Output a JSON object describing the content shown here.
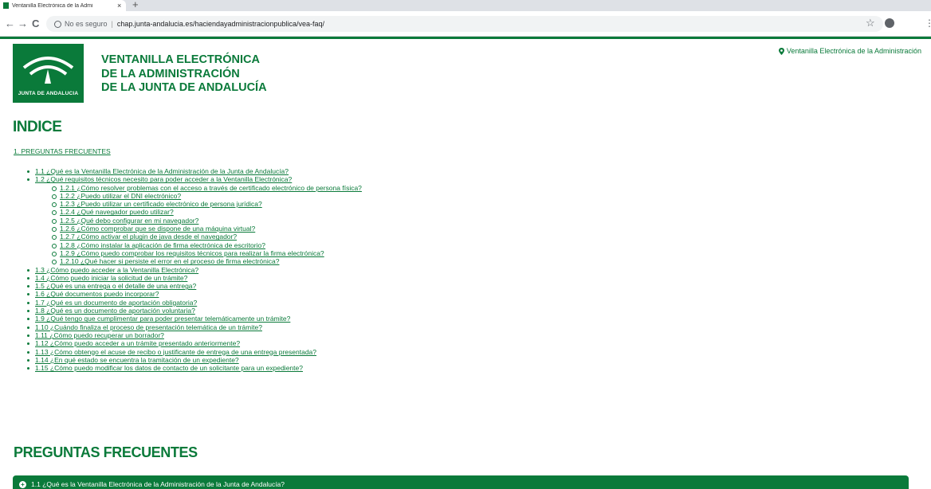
{
  "browser": {
    "tab_title": "Ventanilla Electrónica de la Admi",
    "tab_close": "×",
    "new_tab": "+",
    "back": "←",
    "forward": "→",
    "reload": "C",
    "security_label": "No es seguro",
    "url": "chap.junta-andalucia.es/haciendayadministracionpublica/vea-faq/",
    "star": "☆",
    "menu": "⋮"
  },
  "header": {
    "logo_text": "JUNTA DE ANDALUCIA",
    "title_line1": "VENTANILLA ELECTRÓNICA",
    "title_line2": "DE LA ADMINISTRACIÓN",
    "title_line3": "DE LA JUNTA DE ANDALUCÍA",
    "top_link": "Ventanilla Electrónica de la Administración"
  },
  "index": {
    "heading": "INDICE",
    "section_link": "1. PREGUNTAS FRECUENTES",
    "items": [
      {
        "label": "1.1 ¿Qué es la Ventanilla Electrónica de la Administración de la Junta de Andalucía?"
      },
      {
        "label": "1.2 ¿Qué requisitos técnicos necesito para poder acceder a la Ventanilla Electrónica?",
        "sub": [
          "1.2.1 ¿Cómo resolver problemas con el acceso a través de certificado electrónico de persona física?",
          "1.2.2 ¿Puedo utilizar el DNI electrónico?",
          "1.2.3 ¿Puedo utilizar un certificado electrónico de persona jurídica?",
          "1.2.4 ¿Qué navegador puedo utilizar?",
          "1.2.5 ¿Qué debo configurar en mi navegador?",
          "1.2.6 ¿Cómo comprobar que se dispone de una máquina virtual?",
          "1.2.7 ¿Cómo activar el plugin de java desde el navegador?",
          "1.2.8 ¿Cómo instalar la aplicación de firma electrónica de escritorio?",
          "1.2.9 ¿Cómo puedo comprobar los requisitos técnicos para realizar la firma electrónica?",
          "1.2.10 ¿Qué hacer si persiste el error en el proceso de firma electrónica?"
        ]
      },
      {
        "label": "1.3 ¿Cómo puedo acceder a la Ventanilla Electrónica?"
      },
      {
        "label": "1.4 ¿Cómo puedo iniciar la solicitud de un trámite?"
      },
      {
        "label": "1.5 ¿Qué es una entrega o el detalle de una entrega?"
      },
      {
        "label": "1.6 ¿Qué documentos puedo incorporar?"
      },
      {
        "label": "1.7 ¿Qué es un documento de aportación obligatoria?"
      },
      {
        "label": "1.8 ¿Qué es un documento de aportación voluntaria?"
      },
      {
        "label": "1.9 ¿Qué tengo que cumplimentar para poder presentar telemáticamente un trámite?"
      },
      {
        "label": "1.10 ¿Cuándo finaliza el proceso de presentación telemática de un trámite?"
      },
      {
        "label": "1.11 ¿Cómo puedo recuperar un borrador?"
      },
      {
        "label": "1.12 ¿Cómo puedo acceder a un trámite presentado anteriormente?"
      },
      {
        "label": "1.13 ¿Cómo obtengo el acuse de recibo o justificante de entrega de una entrega presentada?"
      },
      {
        "label": "1.14 ¿En qué estado se encuentra la tramitación de un expediente?"
      },
      {
        "label": "1.15 ¿Cómo puedo modificar los datos de contacto de un solicitante para un expediente?"
      }
    ]
  },
  "faq": {
    "heading": "PREGUNTAS FRECUENTES",
    "first_question": "1.1 ¿Qué es la Ventanilla Electrónica de la Administración de la Junta de Andalucía?",
    "expand_symbol": "+"
  },
  "colors": {
    "brand_green": "#0a7a3a"
  }
}
